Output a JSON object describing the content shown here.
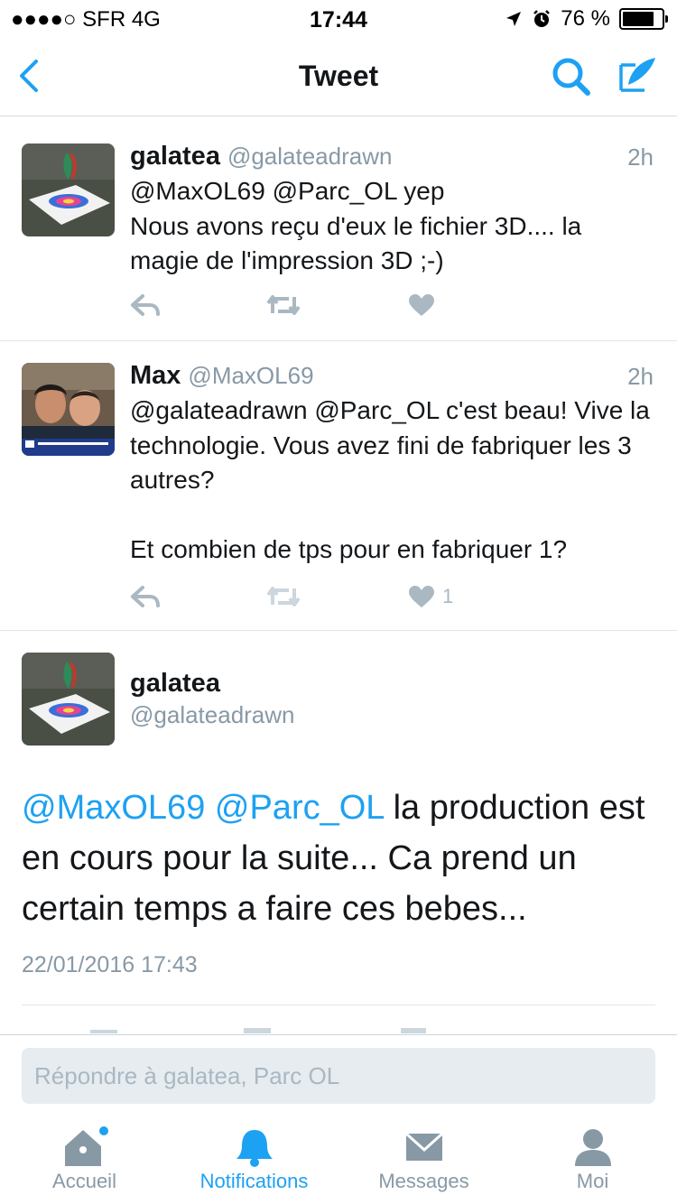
{
  "status_bar": {
    "carrier": "●●●●○ SFR   4G",
    "time": "17:44",
    "battery": "76 %"
  },
  "nav": {
    "title": "Tweet",
    "back_icon": "chevron-left-icon",
    "search_icon": "search-icon",
    "compose_icon": "compose-icon"
  },
  "tweets": [
    {
      "name": "galatea",
      "handle": "@galateadrawn",
      "time": "2h",
      "text": "@MaxOL69 @Parc_OL yep\nNous avons reçu d'eux le fichier 3D.... la magie de l'impression 3D ;-)",
      "likes": ""
    },
    {
      "name": "Max",
      "handle": "@MaxOL69",
      "time": "2h",
      "text": "@galateadrawn @Parc_OL c'est beau! Vive la technologie. Vous avez fini de fabriquer les 3 autres?\n\nEt combien de tps pour en fabriquer 1?",
      "likes": "1"
    }
  ],
  "focused_tweet": {
    "name": "galatea",
    "handle": "@galateadrawn",
    "mention1": "@MaxOL69",
    "mention2": "@Parc_OL",
    "text": " la production est en cours pour la suite... Ca prend un certain temps a faire ces bebes...",
    "date": "22/01/2016 17:43"
  },
  "reply": {
    "placeholder": "Répondre à galatea, Parc OL"
  },
  "tabs": [
    {
      "label": "Accueil",
      "icon": "home-icon"
    },
    {
      "label": "Notifications",
      "icon": "bell-icon"
    },
    {
      "label": "Messages",
      "icon": "envelope-icon"
    },
    {
      "label": "Moi",
      "icon": "person-icon"
    }
  ],
  "colors": {
    "accent": "#1da1f2",
    "muted": "#8899a6",
    "action_icon": "#aab8c2"
  }
}
